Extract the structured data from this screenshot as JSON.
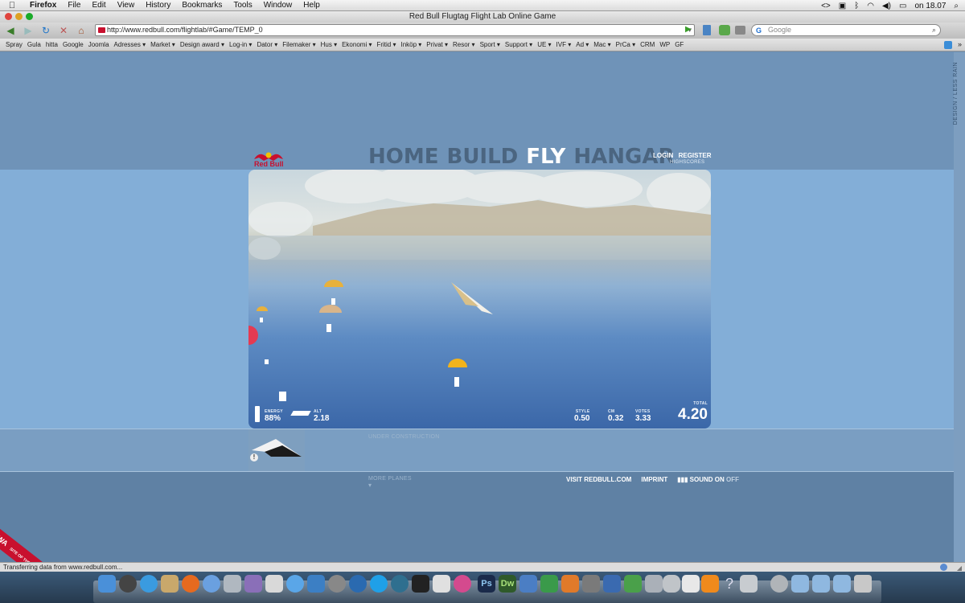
{
  "menubar": {
    "apple": "",
    "items": [
      "Firefox",
      "File",
      "Edit",
      "View",
      "History",
      "Bookmarks",
      "Tools",
      "Window",
      "Help"
    ],
    "clock": "on 18.07"
  },
  "window": {
    "title": "Red Bull Flugtag Flight Lab Online Game"
  },
  "navbar": {
    "url": "http://www.redbull.com/flightlab/#Game/TEMP_0",
    "search_placeholder": "Google"
  },
  "bookmarks": [
    "Spray",
    "Gula",
    "hitta",
    "Google",
    "Joomla",
    "Adresses ▾",
    "Market ▾",
    "Design award ▾",
    "Log-in ▾",
    "Dator ▾",
    "Filemaker ▾",
    "Hus ▾",
    "Ekonomi ▾",
    "Fritid ▾",
    "Inköp ▾",
    "Privat ▾",
    "Resor ▾",
    "Sport ▾",
    "Support ▾",
    "UE ▾",
    "IVF ▾",
    "Ad ▾",
    "Mac ▾",
    "PrCa ▾",
    "CRM",
    "WP",
    "GF"
  ],
  "site": {
    "side_label": "DESIGN / LESS RAIN",
    "logo_text": "Red Bull",
    "nav": [
      "HOME",
      "BUILD",
      "FLY",
      "HANGAR"
    ],
    "active_nav": "FLY",
    "login": "LOGIN",
    "register": "REGISTER",
    "highscores": "HIGHSCORES",
    "under_construction": "UNDER CONSTRUCTION",
    "more_planes": "MORE PLANES",
    "visit": "VISIT REDBULL.COM",
    "imprint": "IMPRINT",
    "sound": "SOUND",
    "sound_on": "ON",
    "sound_off": "OFF",
    "awa_badge": "AWA",
    "awa_sub": "SITE OF THE MONTH"
  },
  "hud": {
    "energy_label": "ENERGY",
    "energy_value": "88%",
    "alt_label": "ALT",
    "alt_value": "2.18",
    "style_label": "STYLE",
    "style_value": "0.50",
    "cm_label": "CM",
    "cm_value": "0.32",
    "votes_label": "VOTES",
    "votes_value": "3.33",
    "total_label": "TOTAL",
    "total_value": "4.20"
  },
  "status": {
    "text": "Transferring data from www.redbull.com..."
  },
  "colors": {
    "accent": "#c8102e",
    "page_bg": "#6f93b8",
    "nav_inactive": "#4b6580"
  }
}
